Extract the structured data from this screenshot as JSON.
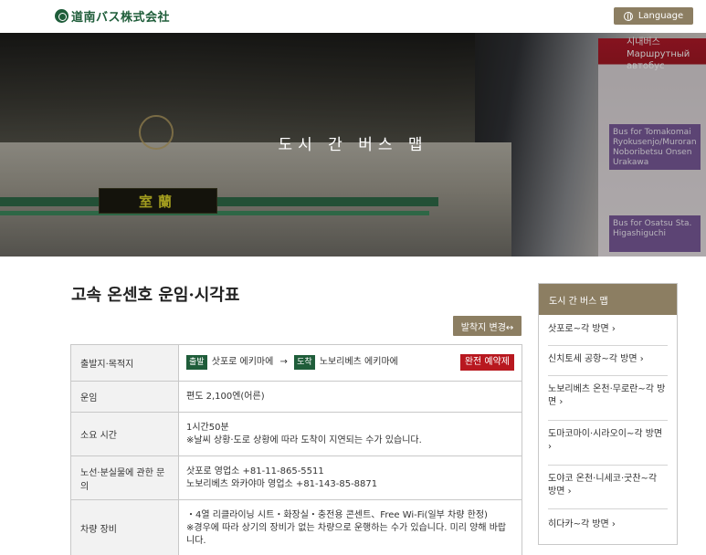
{
  "header": {
    "logo_text": "道南バス株式会社",
    "language_label": "Language"
  },
  "hero": {
    "title": "도시 간 버스 맵",
    "bus_destination": "室蘭",
    "sign_text_1": "시내버스",
    "sign_text_2": "Маршрутный автобус",
    "panel_1": "Bus for Tomakomai Ryokusenjo/Muroran Noboribetsu Onsen Urakawa",
    "panel_2": "Bus for Osatsu Sta. Higashiguchi"
  },
  "main": {
    "page_title": "고속 온센호 운임·시각표",
    "change_button": "발착지 변경↔",
    "table": {
      "rows": [
        {
          "label": "출발지·목적지",
          "dep_tag": "출발",
          "dep_place": "삿포로 에키마에",
          "arrow": "→",
          "arr_tag": "도착",
          "arr_place": "노보리베츠 에키마에",
          "badge": "완전 예약제"
        },
        {
          "label": "운임",
          "value": "편도 2,100엔(어른)"
        },
        {
          "label": "소요 시간",
          "line1": "1시간50분",
          "line2": "※날씨 상황·도로 상황에 따라 도착이 지연되는 수가 있습니다."
        },
        {
          "label": "노선·분실물에 관한 문의",
          "line1": "삿포로 영업소 +81-11-865-5511",
          "line2": "노보리베츠 와카야마 영업소 +81-143-85-8871"
        },
        {
          "label": "차량 장비",
          "line1": "・4열 리클라이닝 시트・화장실・충전용 콘센트、Free Wi-Fi(일부 차량 한정)",
          "line2": "※경우에 따라 상기의 장비가 없는 차량으로 운행하는 수가 있습니다. 미리 양해 바랍니다."
        }
      ]
    }
  },
  "sidebar": {
    "title": "도시 간 버스 맵",
    "items": [
      "삿포로~각 방면 ›",
      "신치토세 공항~각 방면 ›",
      "노보리베츠 온천·무로란~각 방면 ›",
      "도마코마이·시라오이~각 방면 ›",
      "도야코 온천·니세코·굿찬~각 방면 ›",
      "히다카~각 방면 ›"
    ]
  },
  "colors": {
    "brand_green": "#1f5d3a",
    "accent_brown": "#8c7e62",
    "badge_red": "#b8181f"
  }
}
